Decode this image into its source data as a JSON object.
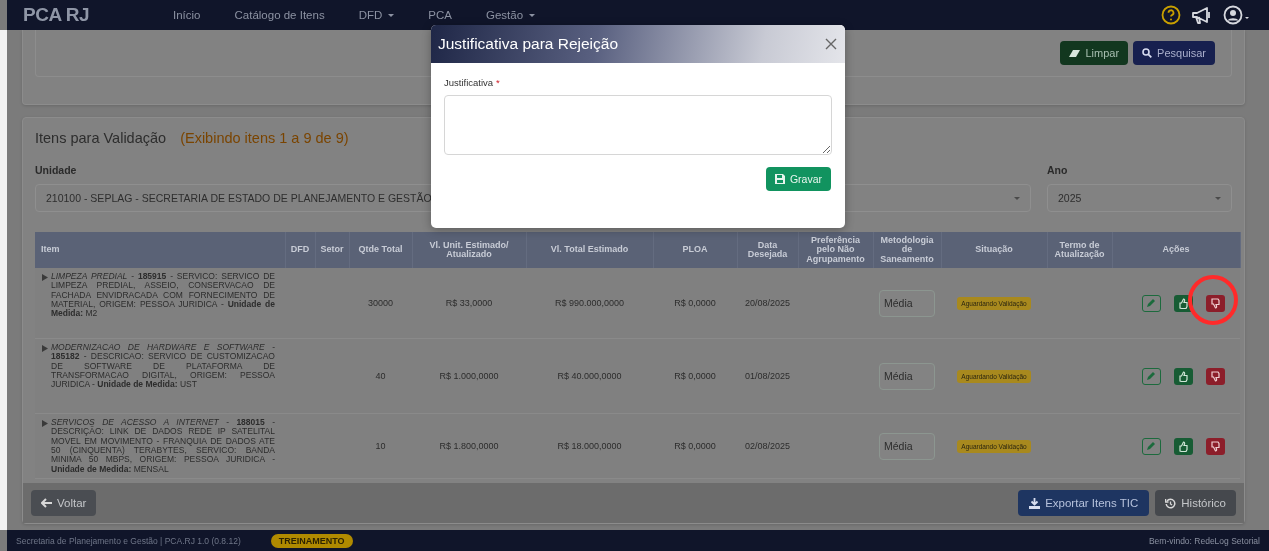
{
  "navbar": {
    "brand": "PCA RJ",
    "menu": [
      {
        "label": "Início",
        "dropdown": false
      },
      {
        "label": "Catálogo de Itens",
        "dropdown": false
      },
      {
        "label": "DFD",
        "dropdown": true
      },
      {
        "label": "PCA",
        "dropdown": false
      },
      {
        "label": "Gestão",
        "dropdown": true
      }
    ]
  },
  "search_card": {
    "buttons": [
      {
        "label": "Limpar",
        "kind": "clear"
      },
      {
        "label": "Pesquisar",
        "kind": "search"
      }
    ]
  },
  "validation": {
    "title": "Itens para Validação",
    "subtitle": "(Exibindo itens 1 a 9 de 9)",
    "filters": [
      {
        "label": "Unidade",
        "value": "210100 - SEPLAG - SECRETARIA DE ESTADO DE PLANEJAMENTO E GESTÃO",
        "kind": "wide"
      },
      {
        "label": "Ano",
        "value": "2025",
        "kind": "narrow"
      }
    ],
    "columns": [
      "Item",
      "DFD",
      "Setor",
      "Qtde Total",
      "Vl. Unit. Estimado/ Atualizado",
      "Vl. Total Estimado",
      "PLOA",
      "Data Desejada",
      "Preferência pelo Não Agrupamento",
      "Metodologia de Saneamento",
      "Situação",
      "Termo de Atualização",
      "Ações"
    ],
    "rows": [
      {
        "item": "*LIMPEZA PREDIAL* - **185915** - SERVICO: SERVICO DE LIMPEZA PREDIAL, ASSEIO, CONSERVACAO DE FACHADA ENVIDRACADA COM FORNECIMENTO DE MATERIAL, ORIGEM: PESSOA JURIDICA - **Unidade de Medida:** M2",
        "qtde": "30000",
        "vl_unit": "R$ 33,0000",
        "vl_total": "R$ 990.000,0000",
        "ploa": "R$ 0,0000",
        "data": "20/08/2025",
        "metodologia": "Média",
        "situacao": "Aguardando Validação",
        "circled": true
      },
      {
        "item": "*MODERNIZACAO DE HARDWARE E SOFTWARE* - **185182** - DESCRICAO: SERVICO DE CUSTOMIZACAO DE SOFTWARE DE PLATAFORMA DE TRANSFORMACAO DIGITAL, ORIGEM: PESSOA JURIDICA - **Unidade de Medida:** UST",
        "qtde": "40",
        "vl_unit": "R$ 1.000,0000",
        "vl_total": "R$ 40.000,0000",
        "ploa": "R$ 0,0000",
        "data": "01/08/2025",
        "metodologia": "Média",
        "situacao": "Aguardando Validação",
        "circled": false
      },
      {
        "item": "*SERVICOS DE ACESSO A INTERNET* - **188015** - DESCRIÇÃO: LINK DE DADOS REDE IP SATELITAL MOVEL EM MOVIMENTO - FRANQUIA DE DADOS ATE 50 (CINQUENTA) TERABYTES, SERVICO: BANDA MINIMA 50 MBPS, ORIGEM: PESSOA JURIDICA - **Unidade de Medida:** MENSAL",
        "qtde": "10",
        "vl_unit": "R$ 1.800,0000",
        "vl_total": "R$ 18.000,0000",
        "ploa": "R$ 0,0000",
        "data": "02/08/2025",
        "metodologia": "Média",
        "situacao": "Aguardando Validação",
        "circled": false
      }
    ]
  },
  "action_bar": {
    "buttons": [
      {
        "label": "Voltar",
        "kind": "back"
      },
      {
        "label": "Exportar Itens TIC",
        "kind": "export"
      },
      {
        "label": "Histórico",
        "kind": "history"
      }
    ]
  },
  "modal": {
    "title": "Justificativa para Rejeição",
    "field_label": "Justificativa",
    "required_mark": "*",
    "button": "Gravar"
  },
  "footer": {
    "text": "Secretaria de Planejamento e Gestão | PCA.RJ 1.0 (0.8.12)",
    "badge": "TREINAMENTO",
    "welcome": "Bem-vindo: RedeLog Setorial"
  }
}
